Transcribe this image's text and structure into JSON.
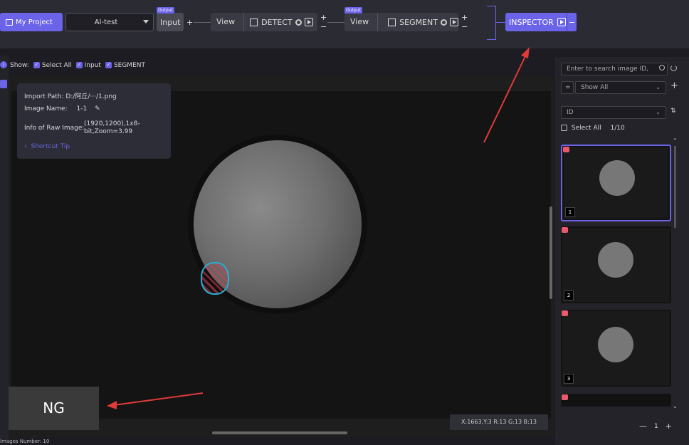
{
  "topbar": {
    "project_label": "My Project",
    "model_select": "AI-test",
    "output_tag": "Output",
    "input_node": "Input",
    "plus": "+",
    "minus": "−",
    "view_label": "View",
    "detect_label": "DETECT",
    "segment_label": "SEGMENT",
    "inspector_label": "INSPECTOR"
  },
  "toolbar": {
    "show_label": "Show:",
    "select_all": "Select All",
    "input": "Input",
    "segment": "SEGMENT"
  },
  "info": {
    "import_path": "Import Path: D:/阿丘/···/1.png",
    "image_name_label": "Image Name:",
    "image_name_value": "1-1",
    "raw_label": "Info of Raw Image:",
    "raw_line1": "(1920,1200),1x8-",
    "raw_line2": "bit,Zoom=3.99",
    "shortcut": "Shortcut Tip"
  },
  "result_label": "NG",
  "coords": "X:1663,Y:3  R:13 G:13 B:13",
  "images_number": "Images Number: 10",
  "right_panel": {
    "search_placeholder": "Enter to search image ID,",
    "filter_equals": "=",
    "filter_value": "Show All",
    "sort_value": "ID",
    "select_all": "Select All",
    "count": "1/10",
    "thumbnails": [
      "1",
      "2",
      "3"
    ],
    "page": "1",
    "minus": "—",
    "plus": "+"
  },
  "colors": {
    "accent": "#6b63e8",
    "badge": "#e85a6e",
    "arrow": "#e03a3a"
  }
}
